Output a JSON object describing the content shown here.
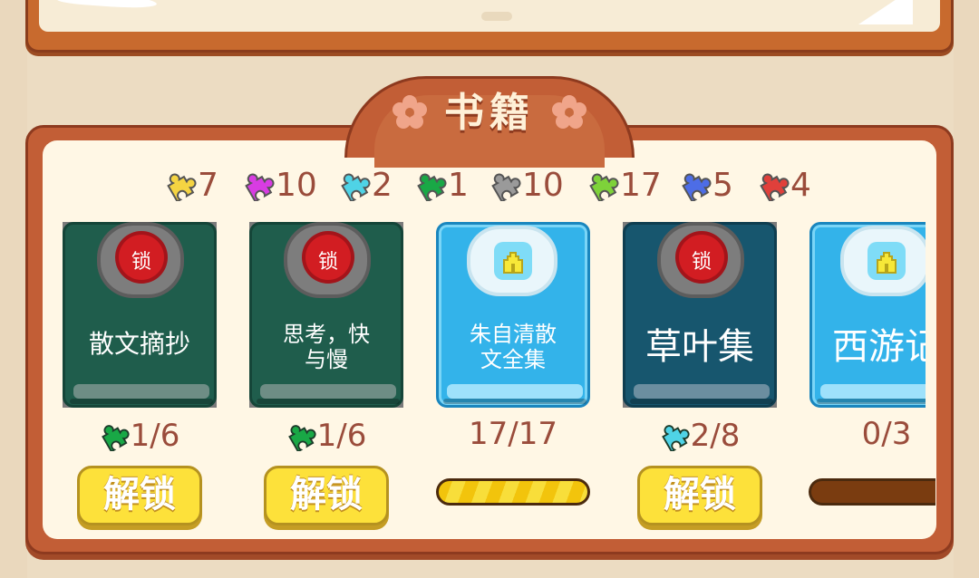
{
  "section_title": "书籍",
  "counters": [
    {
      "color": "#f5d442",
      "value": "7"
    },
    {
      "color": "#d83ce2",
      "value": "10"
    },
    {
      "color": "#4fd3e6",
      "value": "2"
    },
    {
      "color": "#19a846",
      "value": "1"
    },
    {
      "color": "#9a9a9a",
      "value": "10"
    },
    {
      "color": "#7ed23a",
      "value": "17"
    },
    {
      "color": "#4d6de6",
      "value": "5"
    },
    {
      "color": "#e0403b",
      "value": "4"
    }
  ],
  "books": [
    {
      "title": "散文摘抄",
      "status": "locked",
      "lock_text": "锁",
      "progress": "1/6",
      "piece_color": "#19a846",
      "button": "解锁"
    },
    {
      "title": "思考，快\n与慢",
      "status": "locked",
      "lock_text": "锁",
      "progress": "1/6",
      "piece_color": "#19a846",
      "button": "解锁"
    },
    {
      "title": "朱自清散\n文全集",
      "status": "open",
      "progress": "17/17",
      "progress_fraction": 1.0
    },
    {
      "title": "草叶集",
      "status": "locked",
      "lock_text": "锁",
      "progress": "2/8",
      "piece_color": "#4fd3e6",
      "button": "解锁"
    },
    {
      "title": "西游记",
      "status": "open",
      "progress": "0/3",
      "progress_fraction": 0.0
    }
  ]
}
